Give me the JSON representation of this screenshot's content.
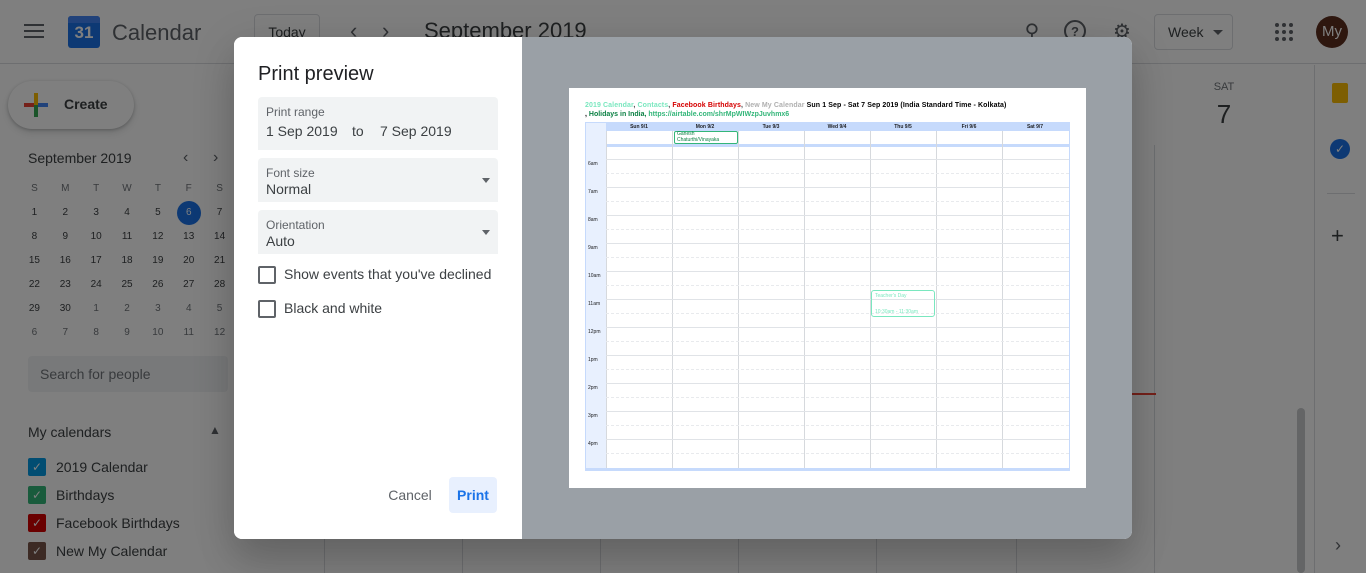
{
  "app": {
    "name": "Calendar",
    "logo_day": "31",
    "today_button": "Today",
    "current_month": "September 2019",
    "view_select": "Week",
    "avatar_initials": "My"
  },
  "sidebar": {
    "create_label": "Create",
    "mini_calendar": {
      "title": "September 2019",
      "weekdays": [
        "S",
        "M",
        "T",
        "W",
        "T",
        "F",
        "S"
      ],
      "weeks": [
        [
          "1",
          "2",
          "3",
          "4",
          "5",
          "6",
          "7"
        ],
        [
          "8",
          "9",
          "10",
          "11",
          "12",
          "13",
          "14"
        ],
        [
          "15",
          "16",
          "17",
          "18",
          "19",
          "20",
          "21"
        ],
        [
          "22",
          "23",
          "24",
          "25",
          "26",
          "27",
          "28"
        ],
        [
          "29",
          "30",
          "1",
          "2",
          "3",
          "4",
          "5"
        ],
        [
          "6",
          "7",
          "8",
          "9",
          "10",
          "11",
          "12"
        ]
      ],
      "today": "6"
    },
    "search_people_placeholder": "Search for people",
    "my_calendars_title": "My calendars",
    "calendars": [
      {
        "label": "2019 Calendar",
        "color": "#039be5"
      },
      {
        "label": "Birthdays",
        "color": "#33b679"
      },
      {
        "label": "Facebook Birthdays",
        "color": "#d50000"
      },
      {
        "label": "New My Calendar",
        "color": "#795548"
      }
    ]
  },
  "week_view": {
    "visible_day_header": {
      "dow": "SAT",
      "date": "7"
    }
  },
  "print_dialog": {
    "title": "Print preview",
    "print_range": {
      "label": "Print range",
      "start": "1 Sep 2019",
      "to": "to",
      "end": "7 Sep 2019"
    },
    "font_size": {
      "label": "Font size",
      "value": "Normal"
    },
    "orientation": {
      "label": "Orientation",
      "value": "Auto"
    },
    "show_declined_label": "Show events that you've declined",
    "black_white_label": "Black and white",
    "cancel_label": "Cancel",
    "print_label": "Print",
    "preview": {
      "header_calendars": [
        {
          "text": "2019 Calendar",
          "color": "#7ae7bf"
        },
        {
          "text": "Contacts",
          "color": "#7ae7bf"
        },
        {
          "text": "Facebook Birthdays",
          "color": "#d50000"
        },
        {
          "text": "New My Calendar",
          "color": "#b0b0b0"
        }
      ],
      "header_range": "Sun 1 Sep - Sat 7 Sep 2019 (India Standard Time - Kolkata)",
      "header_line2_a": "Holidays in India",
      "header_line2_b": "https://airtable.com/shrMpWIWzpJuvhmx6",
      "day_names": [
        "Sun 9/1",
        "Mon 9/2",
        "Tue 9/3",
        "Wed 9/4",
        "Thu 9/5",
        "Fri 9/6",
        "Sat 9/7"
      ],
      "times": [
        "6am",
        "7am",
        "8am",
        "9am",
        "10am",
        "11am",
        "12pm",
        "1pm",
        "2pm",
        "3pm",
        "4pm"
      ],
      "events": [
        {
          "title": "Ganesh Chaturthi/Vinayaka",
          "day": "Mon 9/2",
          "type": "all-day"
        },
        {
          "title": "Teacher's Day",
          "time": "10:30am - 11:30am",
          "day": "Thu 9/5"
        }
      ]
    }
  }
}
